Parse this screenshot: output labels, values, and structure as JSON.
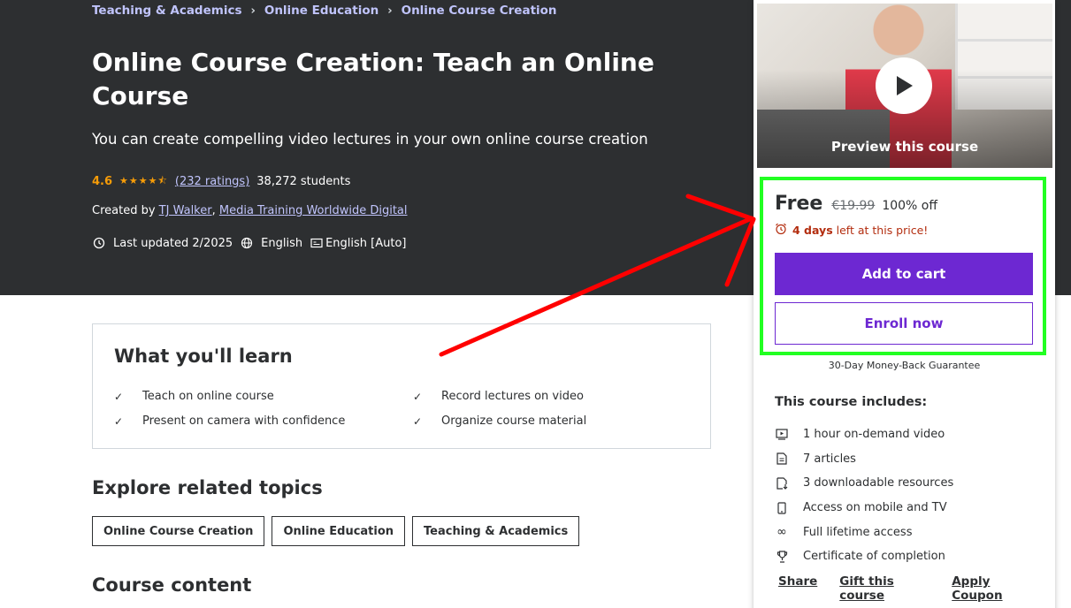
{
  "breadcrumb": [
    "Teaching & Academics",
    "Online Education",
    "Online Course Creation"
  ],
  "course": {
    "title": "Online Course Creation: Teach an Online Course",
    "subtitle": "You can create compelling video lectures in your own online course creation",
    "rating": "4.6",
    "stars": "★★★★⯪",
    "ratings_count": "(232 ratings)",
    "students": "38,272 students",
    "created_by_label": "Created by",
    "instructors": [
      "TJ Walker",
      "Media Training Worldwide Digital"
    ],
    "last_updated": "Last updated 2/2025",
    "language": "English",
    "captions": "English [Auto]"
  },
  "sidebar": {
    "preview_label": "Preview this course",
    "price": "Free",
    "original_price": "€19.99",
    "discount": "100% off",
    "timer_days": "4 days",
    "timer_suffix": "left at this price!",
    "add_to_cart": "Add to cart",
    "enroll_now": "Enroll now",
    "guarantee": "30-Day Money-Back Guarantee",
    "includes_title": "This course includes:",
    "includes": [
      {
        "icon": "video-icon",
        "text": "1 hour on-demand video"
      },
      {
        "icon": "article-icon",
        "text": "7 articles"
      },
      {
        "icon": "download-file-icon",
        "text": "3 downloadable resources"
      },
      {
        "icon": "mobile-icon",
        "text": "Access on mobile and TV"
      },
      {
        "icon": "infinity-icon",
        "text": "Full lifetime access"
      },
      {
        "icon": "trophy-icon",
        "text": "Certificate of completion"
      }
    ],
    "links": [
      "Share",
      "Gift this course",
      "Apply Coupon"
    ]
  },
  "learn": {
    "title": "What you'll learn",
    "items": [
      "Teach on online course",
      "Record lectures on video",
      "Present on camera with confidence",
      "Organize course material"
    ]
  },
  "related": {
    "title": "Explore related topics",
    "topics": [
      "Online Course Creation",
      "Online Education",
      "Teaching & Academics"
    ]
  },
  "course_content_title": "Course content",
  "colors": {
    "hero_bg": "#2d2f31",
    "accent_purple": "#6d28d2",
    "link_lavender": "#c0c4fc",
    "star_orange": "#f69c08",
    "timer_red": "#b32d0f",
    "highlight_green": "#22ff22",
    "arrow_red": "#ff0000"
  }
}
